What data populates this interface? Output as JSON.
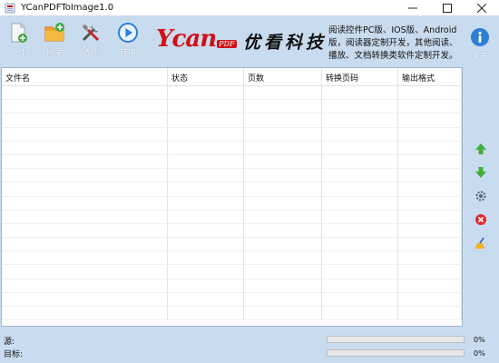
{
  "window": {
    "title": "YCanPDFToImage1.0"
  },
  "toolbar": {
    "file_label": "文件",
    "dir_label": "目录",
    "options_label": "选项",
    "convert_label": "转换",
    "about_label": "关于"
  },
  "brand": {
    "logo_word": "Ycan",
    "logo_sub": "PDF",
    "name_cn": "优看科技",
    "ad_text": "阅读控件PC版、IOS版、Android版，阅读器定制开发，其他阅读、播放、文档转换类软件定制开发。"
  },
  "table": {
    "columns": [
      "文件名",
      "状态",
      "页数",
      "转换页码",
      "输出格式"
    ],
    "rows": []
  },
  "status": {
    "source_label": "源:",
    "target_label": "目标:",
    "source_progress": 0,
    "target_progress": 0,
    "source_pct": "0%",
    "target_pct": "0%"
  },
  "colors": {
    "background": "#c9dbee",
    "accent": "#2f7fd1",
    "brand_red": "#d21016"
  }
}
